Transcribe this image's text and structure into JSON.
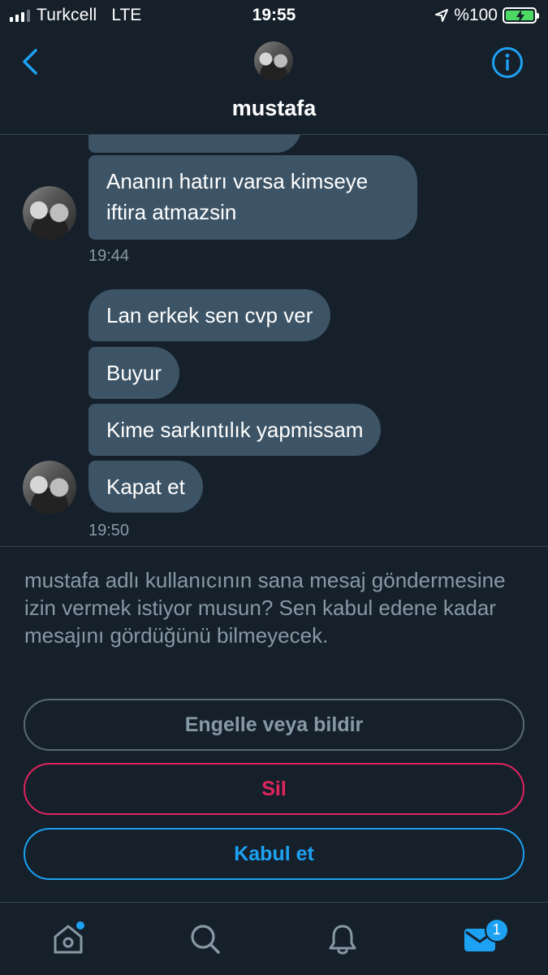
{
  "status_bar": {
    "carrier": "Turkcell",
    "network": "LTE",
    "time": "19:55",
    "battery": "%100"
  },
  "header": {
    "title": "mustafa"
  },
  "messages": {
    "group1": {
      "bubbles": [
        "Ananın hatırı varsa kimseye iftira atmazsin"
      ],
      "time": "19:44"
    },
    "group2": {
      "bubbles": [
        "Lan erkek sen cvp ver",
        "Buyur",
        "Kime sarkıntılık yapmissam",
        "Kapat et"
      ],
      "time": "19:50"
    }
  },
  "request": {
    "text": "mustafa adlı kullanıcının sana mesaj göndermesine izin vermek istiyor musun? Sen kabul edene kadar mesajını gördüğünü bilmeyecek."
  },
  "actions": {
    "block_label": "Engelle veya bildir",
    "delete_label": "Sil",
    "accept_label": "Kabul et"
  },
  "nav": {
    "items": [
      {
        "icon": "home-icon"
      },
      {
        "icon": "search-icon"
      },
      {
        "icon": "bell-icon"
      },
      {
        "icon": "mail-icon",
        "badge": "1"
      }
    ]
  },
  "colors": {
    "background": "#15202b",
    "bubble": "#3d5466",
    "accent": "#1da1f2",
    "danger": "#e0245e",
    "muted": "#8899a6"
  }
}
